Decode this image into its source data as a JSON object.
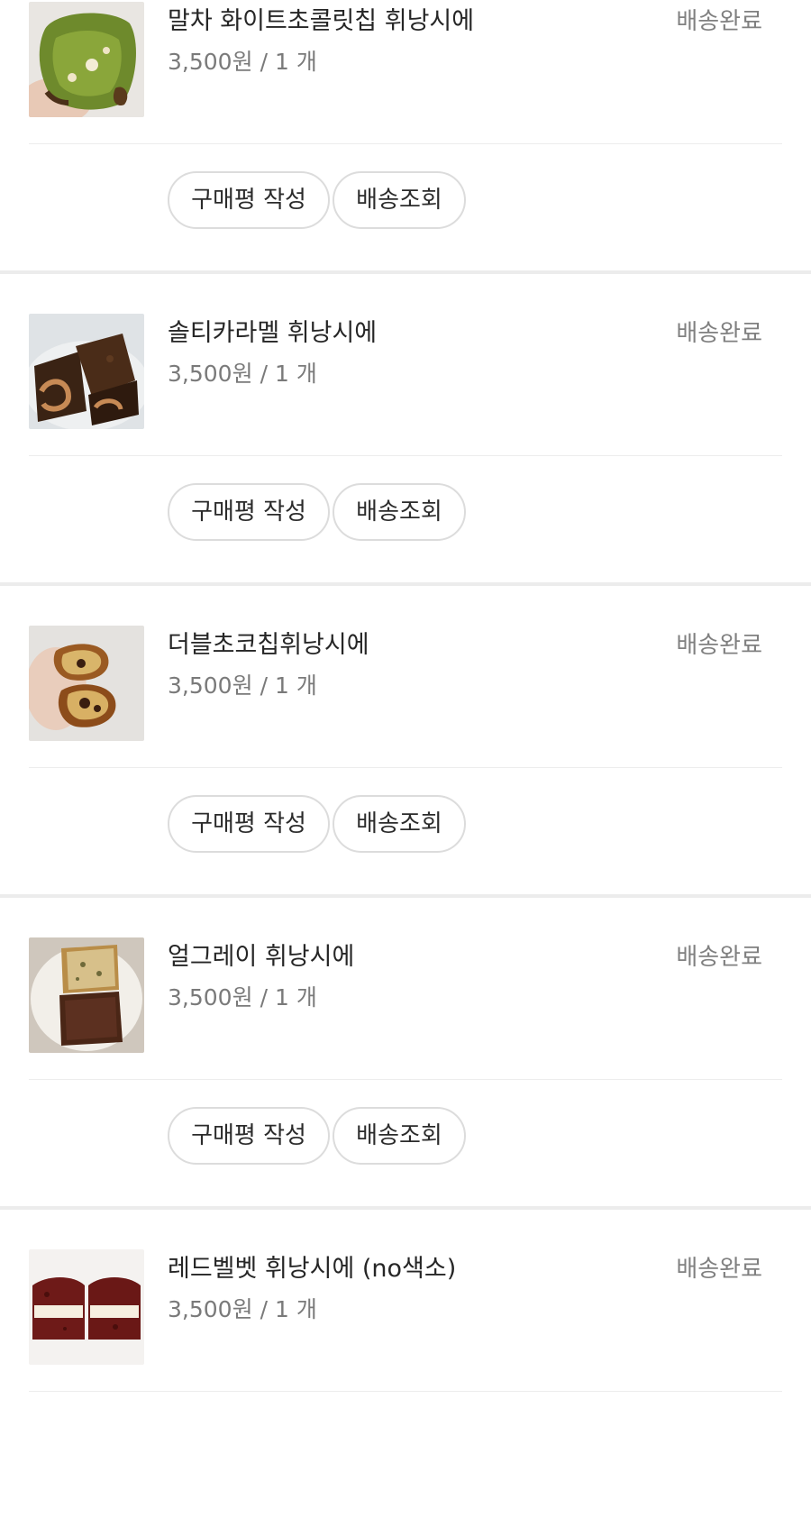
{
  "orders": [
    {
      "name": "말차 화이트초콜릿칩 휘낭시에",
      "price": "3,500원",
      "sep": "/",
      "qty": "1 개",
      "status": "배송완료",
      "review_label": "구매평 작성",
      "track_label": "배송조회"
    },
    {
      "name": "솔티카라멜 휘낭시에",
      "price": "3,500원",
      "sep": "/",
      "qty": "1 개",
      "status": "배송완료",
      "review_label": "구매평 작성",
      "track_label": "배송조회"
    },
    {
      "name": "더블초코칩휘낭시에",
      "price": "3,500원",
      "sep": "/",
      "qty": "1 개",
      "status": "배송완료",
      "review_label": "구매평 작성",
      "track_label": "배송조회"
    },
    {
      "name": "얼그레이 휘낭시에",
      "price": "3,500원",
      "sep": "/",
      "qty": "1 개",
      "status": "배송완료",
      "review_label": "구매평 작성",
      "track_label": "배송조회"
    },
    {
      "name": "레드벨벳 휘낭시에 (no색소)",
      "price": "3,500원",
      "sep": "/",
      "qty": "1 개",
      "status": "배송완료"
    }
  ]
}
